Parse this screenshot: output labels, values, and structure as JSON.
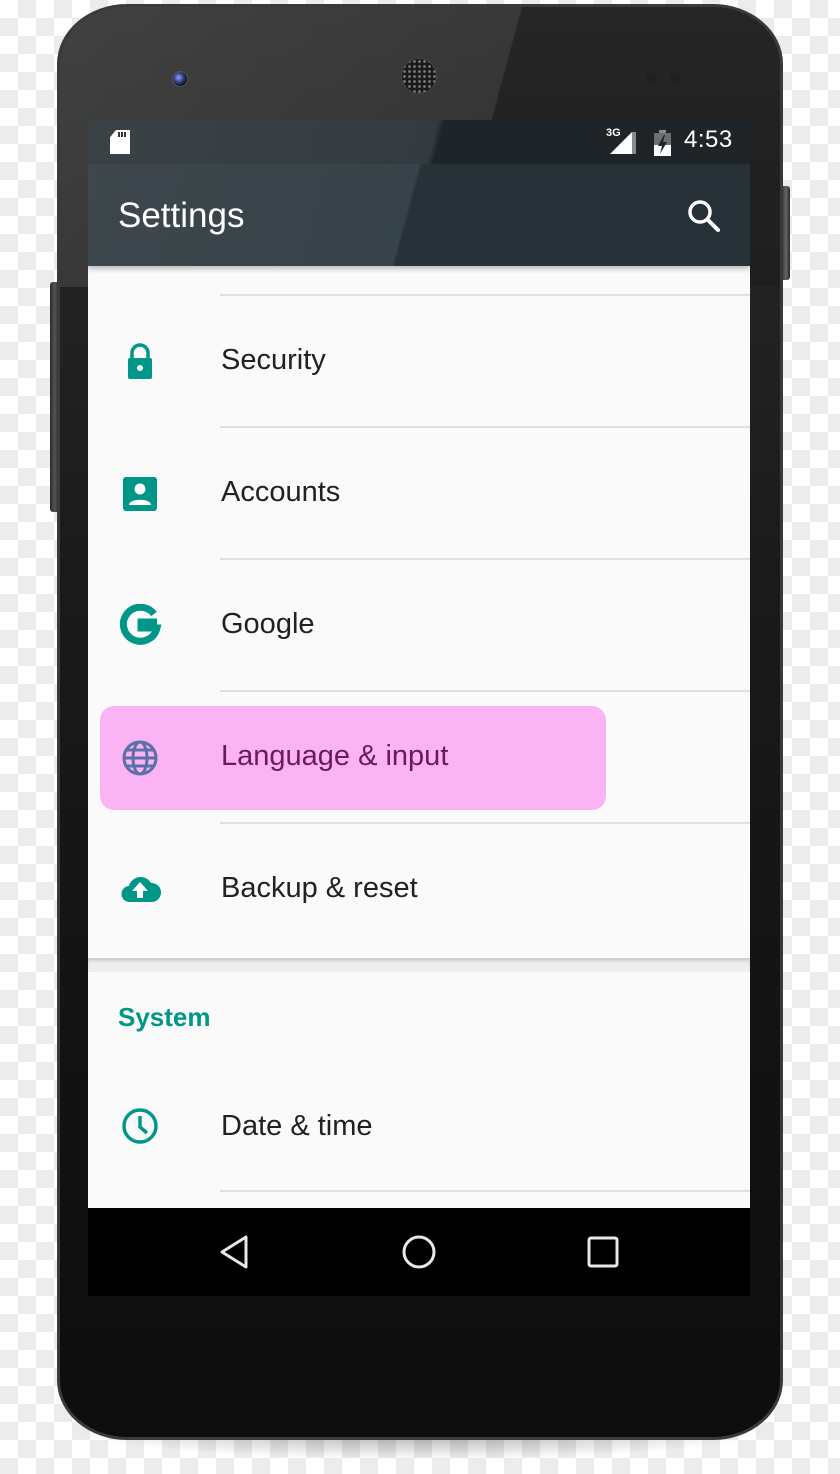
{
  "status_bar": {
    "network_type": "3G",
    "time": "4:53",
    "icons": [
      "sd-card-icon",
      "signal-icon",
      "battery-charging-icon"
    ]
  },
  "toolbar": {
    "title": "Settings",
    "search_icon": "search-icon"
  },
  "personal_items": [
    {
      "label": "Security",
      "icon": "lock-icon"
    },
    {
      "label": "Accounts",
      "icon": "account-box-icon"
    },
    {
      "label": "Google",
      "icon": "google-icon"
    },
    {
      "label": "Language & input",
      "icon": "globe-icon",
      "highlighted": true
    },
    {
      "label": "Backup & reset",
      "icon": "cloud-upload-icon"
    }
  ],
  "system_section": {
    "header": "System",
    "items": [
      {
        "label": "Date & time",
        "icon": "clock-icon"
      }
    ]
  },
  "nav_bar": {
    "buttons": [
      "back",
      "home",
      "recents"
    ]
  },
  "colors": {
    "accent": "#009688",
    "highlight": "#fbb4f3",
    "highlight_text": "#6b1a5c",
    "highlight_icon": "#5b6fa8",
    "toolbar": "#263238"
  }
}
